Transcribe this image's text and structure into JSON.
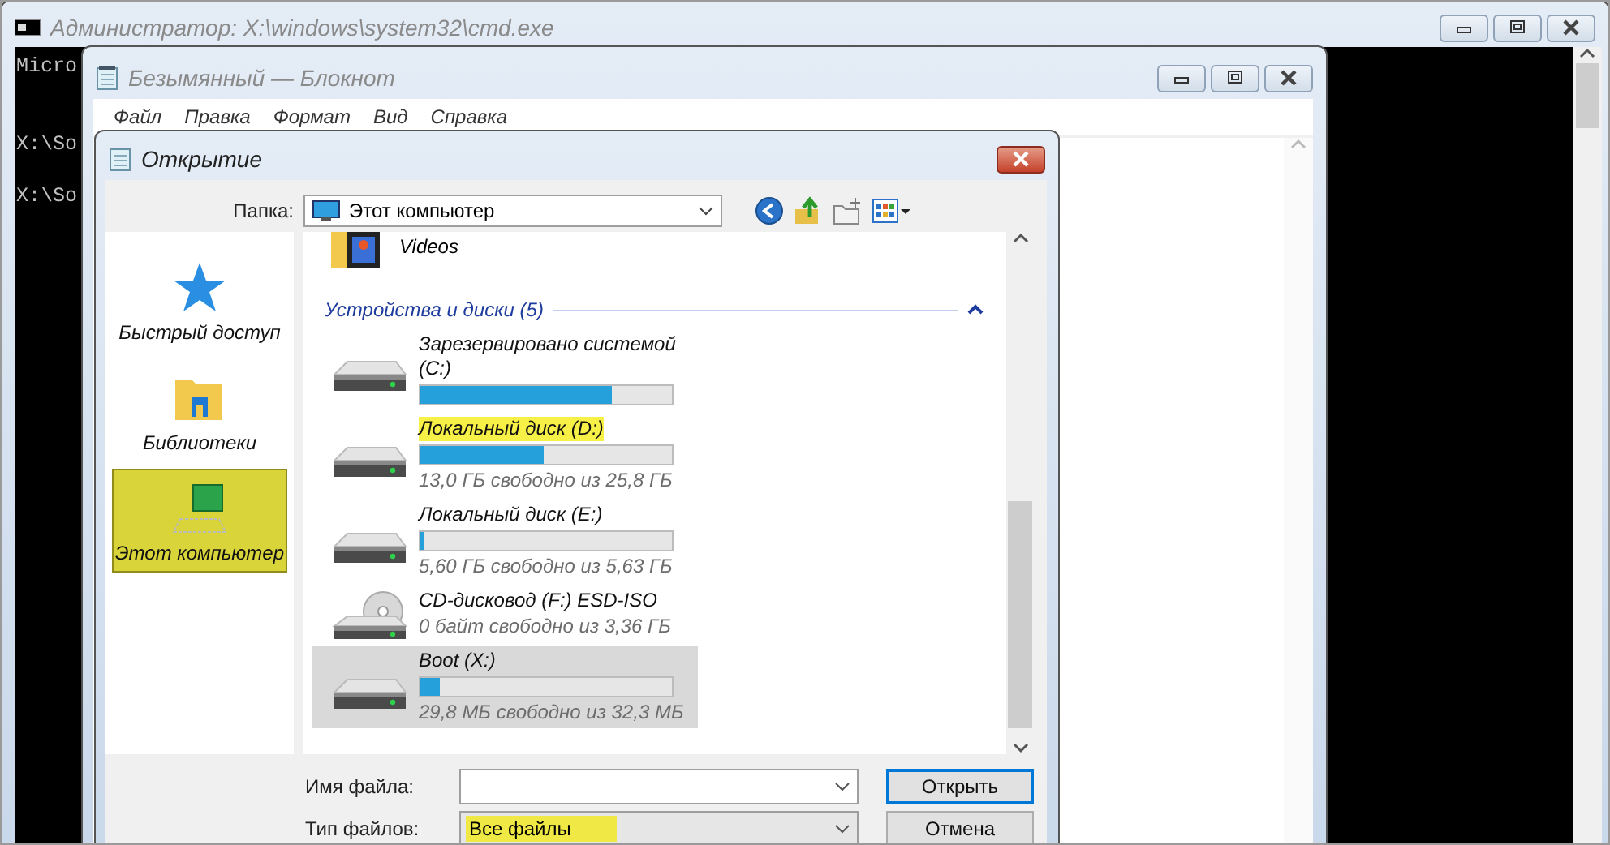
{
  "cmd": {
    "title": "Администратор: X:\\windows\\system32\\cmd.exe",
    "lines": [
      {
        "kind": "text",
        "text": "Micro"
      },
      {
        "kind": "blank"
      },
      {
        "kind": "blank"
      },
      {
        "kind": "text",
        "text": "X:\\So"
      },
      {
        "kind": "blank"
      },
      {
        "kind": "text",
        "text": "X:\\So"
      }
    ]
  },
  "notepad": {
    "title": "Безымянный — Блокнот",
    "menu": [
      "Файл",
      "Правка",
      "Формат",
      "Вид",
      "Справка"
    ]
  },
  "dialog": {
    "title": "Открытие",
    "folder_label": "Папка:",
    "folder": "Этот компьютер",
    "nav": [
      {
        "kind": "star",
        "label": "Быстрый доступ",
        "selected": false
      },
      {
        "kind": "libraries",
        "label": "Библиотеки",
        "selected": false
      },
      {
        "kind": "computer",
        "label": "Этот компьютер",
        "selected": true
      }
    ],
    "top_item": {
      "name": "Videos"
    },
    "group": {
      "title": "Устройства и диски (5)",
      "expanded": true
    },
    "drives": [
      {
        "kind": "disk",
        "name": "Зарезервировано системой (C:)",
        "level": 0.76,
        "highlighted": false,
        "selected": false
      },
      {
        "kind": "disk",
        "name": "Локальный диск (D:)",
        "level": 0.49,
        "free": "13,0 ГБ свободно из 25,8 ГБ",
        "highlighted": true,
        "selected": false
      },
      {
        "kind": "disk",
        "name": "Локальный диск (E:)",
        "level": 0.01,
        "free": "5,60 ГБ свободно из 5,63 ГБ",
        "highlighted": false,
        "selected": false
      },
      {
        "kind": "cd",
        "name": "CD-дисковод (F:) ESD-ISO",
        "free": "0 байт свободно из 3,36 ГБ",
        "highlighted": false,
        "selected": false
      },
      {
        "kind": "disk",
        "name": "Boot (X:)",
        "level": 0.08,
        "free": "29,8 МБ свободно из 32,3 МБ",
        "highlighted": false,
        "selected": true
      }
    ],
    "filename_label": "Имя файла:",
    "filetype_label": "Тип файлов:",
    "filetype": {
      "value": "Все файлы",
      "highlighted": true
    },
    "buttons": [
      {
        "kind": "default",
        "label": "Открыть"
      },
      {
        "kind": "normal",
        "label": "Отмена"
      }
    ]
  }
}
